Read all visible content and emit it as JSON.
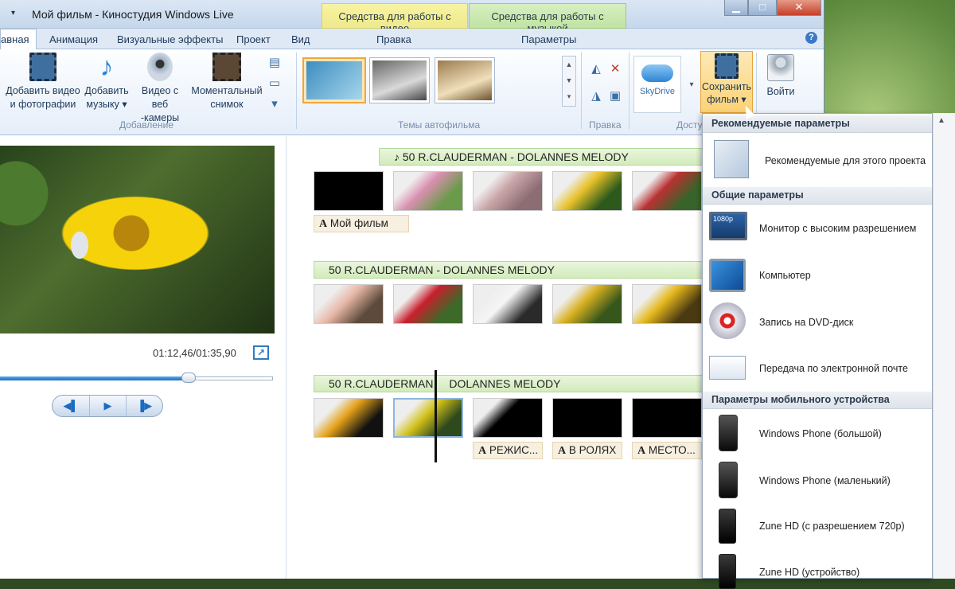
{
  "window": {
    "title": "Мой фильм - Киностудия Windows Live",
    "context_tabs": {
      "video": "Средства для работы с видео",
      "music": "Средства для работы с музыкой"
    },
    "controls": {
      "minimize": "▁",
      "maximize": "□",
      "close": "✕"
    }
  },
  "tabs": {
    "home": "авная",
    "animation": "Анимация",
    "visual_effects": "Визуальные эффекты",
    "project": "Проект",
    "view": "Вид",
    "edit": "Правка",
    "options": "Параметры"
  },
  "ribbon": {
    "add_video": [
      "Добавить видео",
      "и фотографии"
    ],
    "add_music": [
      "Добавить",
      "музыку ▾"
    ],
    "webcam": [
      "Видео с веб",
      "-камеры"
    ],
    "snapshot": [
      "Моментальный",
      "снимок"
    ],
    "group_add": "Добавление",
    "group_themes": "Темы автофильма",
    "group_edit": "Правка",
    "group_share": "Досту",
    "skydrive": "SkyDrive",
    "save_movie": [
      "Сохранить",
      "фильм ▾"
    ],
    "sign_in": "Войти"
  },
  "preview": {
    "time": "01:12,46/01:35,90",
    "progress": 0.69
  },
  "storyboard": {
    "rows": [
      {
        "music": "50 R.CLAUDERMAN - DOLANNES MELODY",
        "captions": [
          "Мой фильм"
        ]
      },
      {
        "music": "50 R.CLAUDERMAN - DOLANNES MELODY",
        "captions": []
      },
      {
        "music_a": "50 R.CLAUDERMAN",
        "music_b": "DOLANNES MELODY",
        "captions": [
          "РЕЖИС...",
          "В РОЛЯХ",
          "МЕСТО..."
        ]
      }
    ]
  },
  "menu": {
    "sec_recommended": "Рекомендуемые параметры",
    "item_recommended": "Рекомендуемые для этого проекта",
    "sec_general": "Общие параметры",
    "item_monitor": "Монитор с высоким разрешением",
    "monitor_badge": "1080p",
    "item_computer": "Компьютер",
    "item_dvd": "Запись на DVD-диск",
    "item_email": "Передача по электронной почте",
    "sec_mobile": "Параметры мобильного устройства",
    "item_wp_large": "Windows Phone (большой)",
    "item_wp_small": "Windows Phone (маленький)",
    "item_zune_720": "Zune HD (с разрешением 720p)",
    "item_zune_dev": "Zune HD (устройство)"
  }
}
